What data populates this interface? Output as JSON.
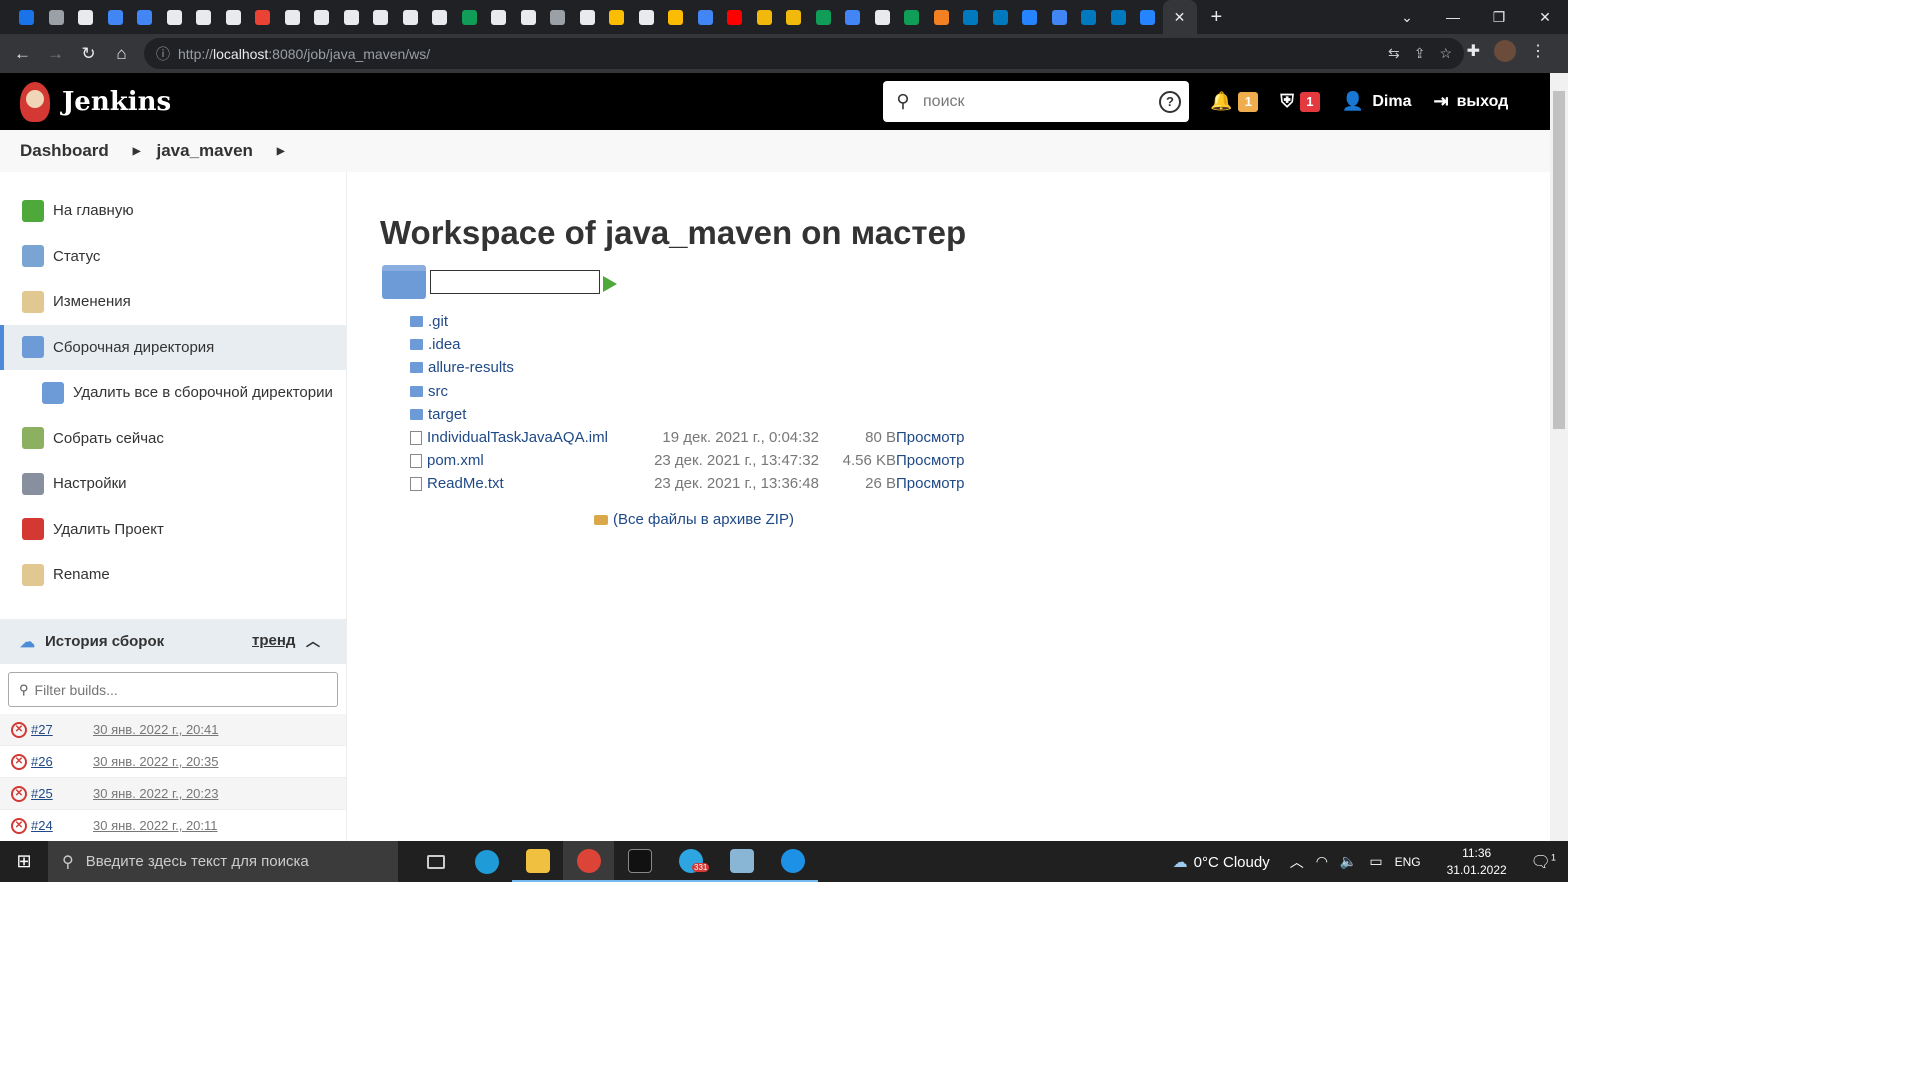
{
  "browser": {
    "tab_colors": [
      "#1a73e8",
      "#9aa0a6",
      "#e8eaed",
      "#4285f4",
      "#4285f4",
      "#e8eaed",
      "#e8eaed",
      "#e8eaed",
      "#ea4335",
      "#e8eaed",
      "#e8eaed",
      "#e8eaed",
      "#e8eaed",
      "#e8eaed",
      "#e8eaed",
      "#0f9d58",
      "#e8eaed",
      "#e8eaed",
      "#9aa0a6",
      "#e8eaed",
      "#fbbc04",
      "#e8eaed",
      "#fbbc04",
      "#4285f4",
      "#ff0000",
      "#f0b90b",
      "#f0b90b",
      "#0f9d58",
      "#4285f4",
      "#e8eaed",
      "#0f9d58",
      "#f48024",
      "#0079bf",
      "#0079bf",
      "#2684ff",
      "#4285f4",
      "#0079bf",
      "#0079bf",
      "#2684ff"
    ],
    "active_tab_close": "✕",
    "new_tab": "+",
    "url_host": "localhost",
    "url_prefix": "http://",
    "url_rest": ":8080/job/java_maven/ws/"
  },
  "header": {
    "title": "Jenkins",
    "search_placeholder": "поиск",
    "help": "?",
    "notifications_count": "1",
    "security_count": "1",
    "user": "Dima",
    "logout": "выход"
  },
  "breadcrumb": {
    "items": [
      "Dashboard",
      "java_maven"
    ]
  },
  "sidebar": {
    "items": [
      {
        "label": "На главную",
        "icon": "up-arrow-icon",
        "color": "#4ea83a"
      },
      {
        "label": "Статус",
        "icon": "magnifier-icon",
        "color": "#7aa5d2"
      },
      {
        "label": "Изменения",
        "icon": "notepad-icon",
        "color": "#e0c890"
      },
      {
        "label": "Сборочная директория",
        "icon": "folder-icon",
        "color": "#6d9bd8"
      },
      {
        "label": "Удалить все в сборочной директории",
        "icon": "delete-folder-icon",
        "color": "#6d9bd8"
      },
      {
        "label": "Собрать сейчас",
        "icon": "clock-icon",
        "color": "#8ab060"
      },
      {
        "label": "Настройки",
        "icon": "gear-icon",
        "color": "#8890a0"
      },
      {
        "label": "Удалить Проект",
        "icon": "no-entry-icon",
        "color": "#d33833"
      },
      {
        "label": "Rename",
        "icon": "notepad-icon",
        "color": "#e0c890"
      }
    ],
    "history_title": "История сборок",
    "trend": "тренд",
    "filter_placeholder": "Filter builds...",
    "builds": [
      {
        "num": "#27",
        "date": "30 янв. 2022 г., 20:41"
      },
      {
        "num": "#26",
        "date": "30 янв. 2022 г., 20:35"
      },
      {
        "num": "#25",
        "date": "30 янв. 2022 г., 20:23"
      },
      {
        "num": "#24",
        "date": "30 янв. 2022 г., 20:11"
      }
    ]
  },
  "main": {
    "title": "Workspace of java_maven on мастер",
    "path_value": "",
    "files": [
      {
        "name": ".git",
        "type": "folder",
        "date": "",
        "size": "",
        "view": ""
      },
      {
        "name": ".idea",
        "type": "folder",
        "date": "",
        "size": "",
        "view": ""
      },
      {
        "name": "allure-results",
        "type": "folder",
        "date": "",
        "size": "",
        "view": ""
      },
      {
        "name": "src",
        "type": "folder",
        "date": "",
        "size": "",
        "view": ""
      },
      {
        "name": "target",
        "type": "folder",
        "date": "",
        "size": "",
        "view": ""
      },
      {
        "name": "IndividualTaskJavaAQA.iml",
        "type": "file",
        "date": "19 дек. 2021 г., 0:04:32",
        "size": "80 B",
        "view": "Просмотр"
      },
      {
        "name": "pom.xml",
        "type": "file",
        "date": "23 дек. 2021 г., 13:47:32",
        "size": "4.56 KB",
        "view": "Просмотр"
      },
      {
        "name": "ReadMe.txt",
        "type": "file",
        "date": "23 дек. 2021 г., 13:36:48",
        "size": "26 B",
        "view": "Просмотр"
      }
    ],
    "zip_link": "(Все файлы в архиве ZIP)"
  },
  "taskbar": {
    "search_placeholder": "Введите здесь текст для поиска",
    "weather": "0°C  Cloudy",
    "lang": "ENG",
    "time": "11:36",
    "date": "31.01.2022",
    "telegram_badge": "331",
    "notif_count": "1"
  }
}
